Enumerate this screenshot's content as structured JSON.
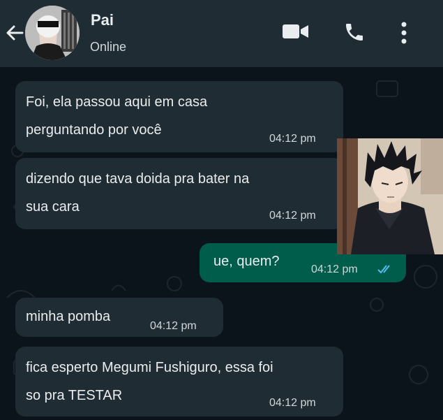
{
  "header": {
    "contact_name": "Pai",
    "status": "Online",
    "icons": [
      "back-arrow-icon",
      "video-call-icon",
      "phone-call-icon",
      "more-options-icon"
    ]
  },
  "messages": [
    {
      "direction": "in",
      "text": "Foi, ela passou aqui em casa\nperguntando por você",
      "time": "04:12 pm"
    },
    {
      "direction": "in",
      "text": "dizendo que tava doida pra bater na\nsua cara",
      "time": "04:12 pm"
    },
    {
      "direction": "out",
      "text": "ue, quem?",
      "time": "04:12 pm",
      "status": "read"
    },
    {
      "direction": "in",
      "text": "minha pomba",
      "time": "04:12 pm"
    },
    {
      "direction": "in",
      "text_before": "fica esperto ",
      "text_name": "Megumi Fushiguro",
      "text_after": ", essa foi\nso pra TESTAR",
      "time": "04:12 pm"
    }
  ],
  "colors": {
    "header_bg": "#1f2c34",
    "chat_bg": "#0b141a",
    "incoming_bubble": "#202c33",
    "outgoing_bubble": "#005c4b",
    "read_tick": "#53bdeb"
  }
}
